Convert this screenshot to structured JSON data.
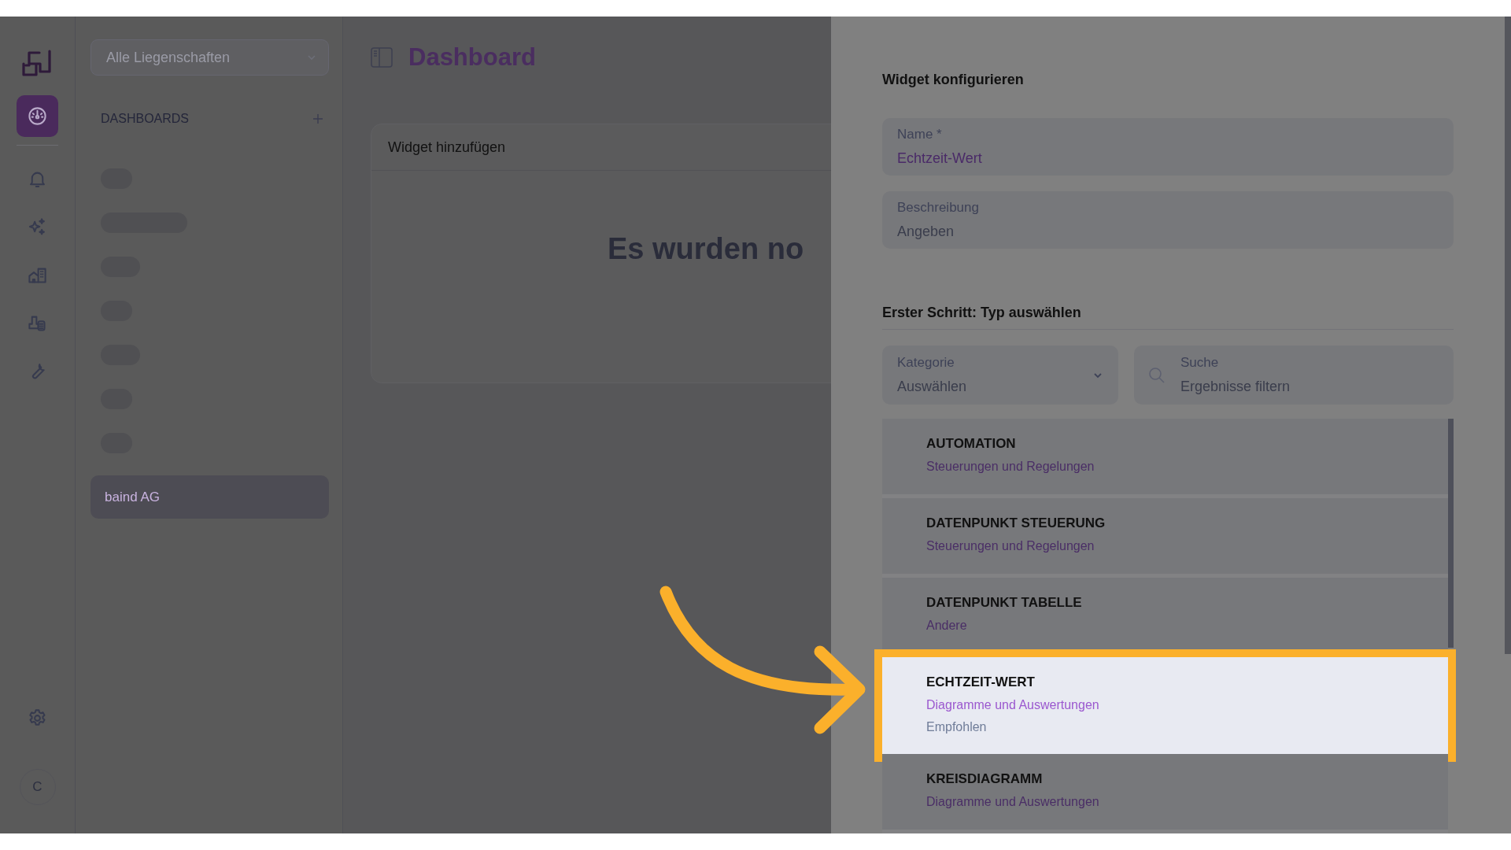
{
  "rail": {
    "items": [
      {
        "selected": true
      },
      {
        "selected": false
      },
      {
        "selected": false
      },
      {
        "selected": false
      },
      {
        "selected": false
      },
      {
        "selected": false
      }
    ],
    "settings": {
      "selected": false
    },
    "avatar": "C"
  },
  "sidebar": {
    "property_select": {
      "placeholder": "Alle Liegenschaften"
    },
    "section_title": "DASHBOARDS",
    "items": [
      {
        "label": "baind AG",
        "selected": true
      }
    ]
  },
  "main": {
    "title": "Dashboard",
    "card": {
      "title": "Widget hinzufügen",
      "empty_text": "Es wurden no"
    }
  },
  "drawer": {
    "title": "Widget konfigurieren",
    "name_field": {
      "label": "Name *",
      "value": "Echtzeit-Wert"
    },
    "description_field": {
      "label": "Beschreibung",
      "placeholder": "Angeben"
    },
    "step_title": "Erster Schritt: Typ auswählen",
    "category_select": {
      "label": "Kategorie",
      "placeholder": "Auswählen"
    },
    "search_field": {
      "label": "Suche",
      "placeholder": "Ergebnisse filtern"
    },
    "widget_types": [
      {
        "title": "AUTOMATION",
        "category": "Steuerungen und Regelungen",
        "selected": false
      },
      {
        "title": "DATENPUNKT STEUERUNG",
        "category": "Steuerungen und Regelungen",
        "selected": false
      },
      {
        "title": "DATENPUNKT TABELLE",
        "category": "Andere",
        "selected": false
      },
      {
        "title": "ECHTZEIT-WERT",
        "category": "Diagramme und Auswertungen",
        "badge": "Empfohlen",
        "selected": true
      },
      {
        "title": "KREISDIAGRAMM",
        "category": "Diagramme und Auswertungen",
        "selected": false
      }
    ]
  }
}
